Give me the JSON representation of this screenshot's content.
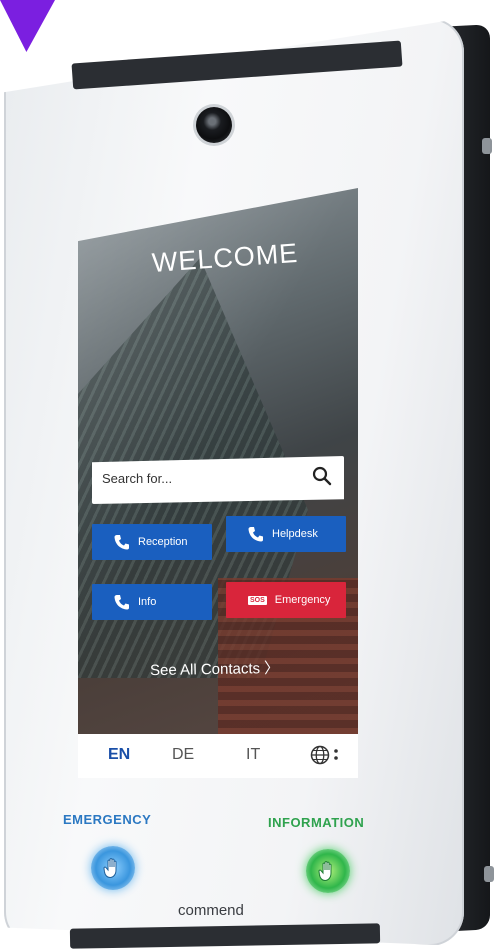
{
  "screen": {
    "welcome": "WELCOME",
    "search": {
      "placeholder": "Search for..."
    },
    "buttons": {
      "reception": "Reception",
      "helpdesk": "Helpdesk",
      "info": "Info",
      "emergency": "Emergency",
      "sos_badge": "SOS"
    },
    "see_all": "See All Contacts",
    "languages": [
      "EN",
      "DE",
      "IT"
    ],
    "active_language": "EN"
  },
  "hardware": {
    "emergency_label": "EMERGENCY",
    "information_label": "INFORMATION",
    "brand": "commend"
  },
  "icons": [
    "search-icon",
    "phone-icon",
    "globe-icon",
    "kebab-menu-icon",
    "hand-icon",
    "camera-lens"
  ],
  "colors": {
    "accent_blue": "#1a5fbf",
    "emergency_red": "#d9253b",
    "emergency_label": "#2b78c2",
    "information_label": "#2fa24e",
    "marker": "#7b1fe0"
  }
}
